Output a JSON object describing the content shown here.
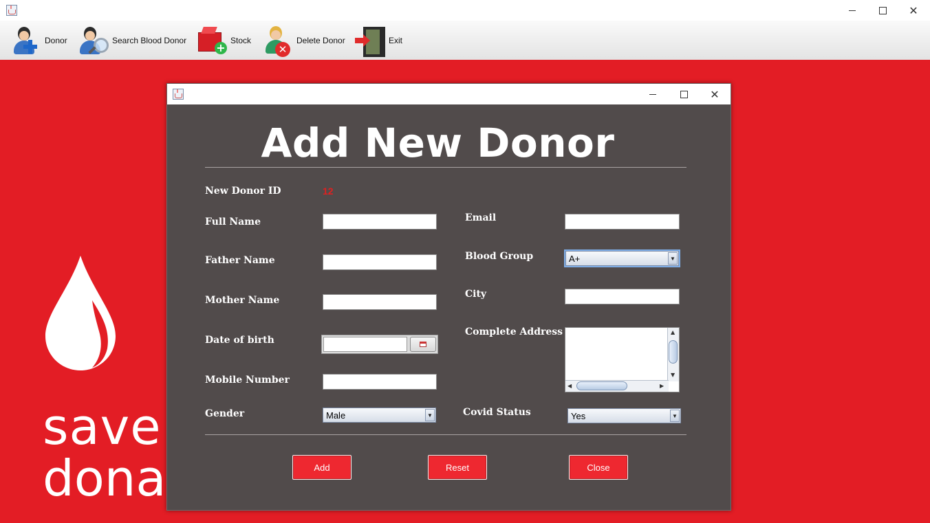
{
  "toolbar": {
    "items": [
      {
        "label": "Donor",
        "icon": "add-donor-icon"
      },
      {
        "label": "Search Blood Donor",
        "icon": "search-donor-icon"
      },
      {
        "label": "Stock",
        "icon": "stock-box-icon"
      },
      {
        "label": "Delete Donor",
        "icon": "delete-donor-icon"
      },
      {
        "label": "Exit",
        "icon": "exit-door-icon"
      }
    ]
  },
  "background": {
    "text_line1": "save",
    "text_line2": "dona",
    "color": "#e31d25"
  },
  "dialog": {
    "title": "Add New Donor",
    "fields": {
      "donor_id_label": "New Donor ID",
      "donor_id_value": "12",
      "full_name_label": "Full Name",
      "father_name_label": "Father Name",
      "mother_name_label": "Mother Name",
      "dob_label": "Date of birth",
      "mobile_label": "Mobile Number",
      "gender_label": "Gender",
      "gender_value": "Male",
      "email_label": "Email",
      "blood_group_label": "Blood Group",
      "blood_group_value": "A+",
      "city_label": "City",
      "address_label": "Complete Address",
      "covid_label": "Covid Status",
      "covid_value": "Yes"
    },
    "buttons": {
      "add": "Add",
      "reset": "Reset",
      "close": "Close"
    },
    "colors": {
      "panel": "#514b4b",
      "button": "#ee2830",
      "id_text": "#e02020"
    }
  }
}
